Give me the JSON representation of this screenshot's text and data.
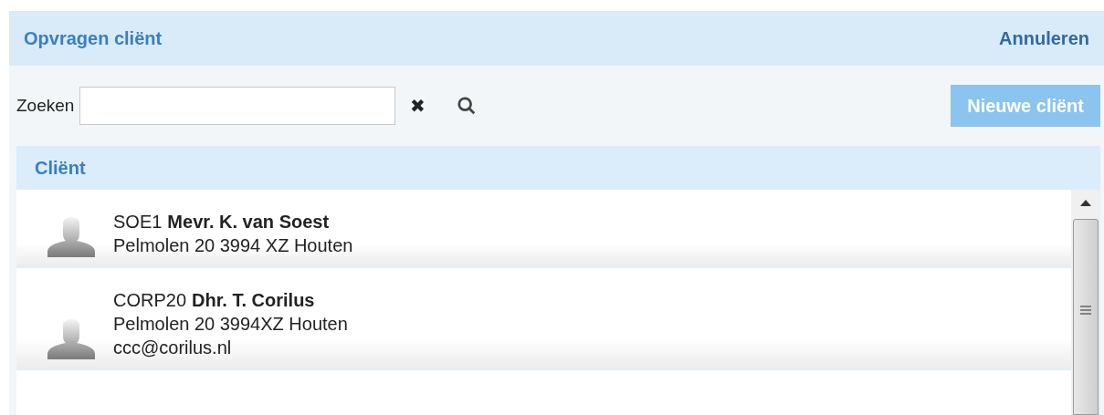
{
  "header": {
    "title": "Opvragen cliënt",
    "cancel": "Annuleren"
  },
  "search": {
    "label": "Zoeken",
    "clear": "✖",
    "new_button": "Nieuwe cliënt"
  },
  "table": {
    "column": "Cliënt",
    "rows": [
      {
        "code": "SOE1",
        "name": "Mevr. K. van Soest",
        "lines": [
          "Pelmolen 20 3994 XZ Houten"
        ]
      },
      {
        "code": "CORP20",
        "name": "Dhr. T. Corilus",
        "lines": [
          "Pelmolen 20 3994XZ Houten",
          "ccc@corilus.nl"
        ]
      }
    ]
  }
}
